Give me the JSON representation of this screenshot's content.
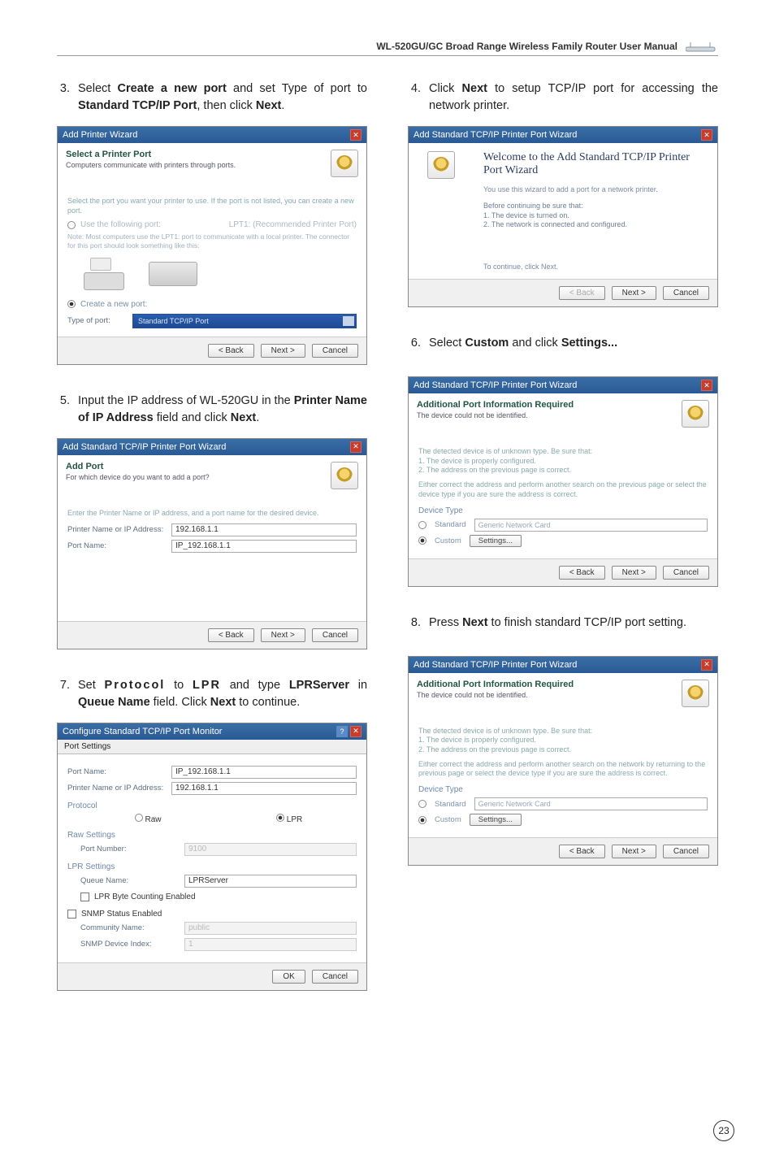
{
  "header": {
    "title": "WL-520GU/GC Broad Range Wireless Family Router User Manual"
  },
  "page_number": "23",
  "steps": {
    "s3": {
      "num": "3.",
      "pre": "Select ",
      "b1": "Create a new port",
      "mid": " and set Type of port to ",
      "b2": "Standard TCP/IP Port",
      "post": ", then click ",
      "b3": "Next",
      "end": "."
    },
    "s4": {
      "num": "4.",
      "pre": "Click ",
      "b1": "Next",
      "post": " to setup TCP/IP port for accessing the network printer."
    },
    "s5": {
      "num": "5.",
      "pre": "Input the IP address of WL-520GU in the ",
      "b1": "Printer Name of IP Address",
      "mid": " field and click ",
      "b2": "Next",
      "end": "."
    },
    "s6": {
      "num": "6.",
      "pre": "Select ",
      "b1": "Custom",
      "mid": " and click ",
      "b2": "Settings...",
      "end": ""
    },
    "s7": {
      "num": "7.",
      "pre": "Set ",
      "b1": "Protocol",
      "mid1": " to ",
      "b2": "LPR",
      "mid2": " and type ",
      "b3": "LPRServer",
      "mid3": " in ",
      "b4": "Queue Name",
      "mid4": " field. Click ",
      "b5": "Next",
      "post": " to continue."
    },
    "s8": {
      "num": "8.",
      "pre": "Press ",
      "b1": "Next",
      "post": " to finish standard TCP/IP port setting."
    }
  },
  "dlg3": {
    "title": "Add Printer Wizard",
    "head_title": "Select a Printer Port",
    "head_sub": "Computers communicate with printers through ports.",
    "note": "Select the port you want your printer to use. If the port is not listed, you can create a new port.",
    "opt_use": "Use the following port:",
    "opt_use_val": "LPT1: (Recommended Printer Port)",
    "blurb": "Note: Most computers use the LPT1: port to communicate with a local printer. The connector for this port should look something like this:",
    "opt_create": "Create a new port:",
    "type_label": "Type of port:",
    "type_val": "Standard TCP/IP Port",
    "btn_back": "< Back",
    "btn_next": "Next >",
    "btn_cancel": "Cancel"
  },
  "dlg4": {
    "title": "Add Standard TCP/IP Printer Port Wizard",
    "welcome": "Welcome to the Add Standard TCP/IP Printer Port Wizard",
    "sub": "You use this wizard to add a port for a network printer.",
    "bul_intro": "Before continuing be sure that:",
    "bul1": "1. The device is turned on.",
    "bul2": "2. The network is connected and configured.",
    "bottom": "To continue, click Next.",
    "btn_back": "< Back",
    "btn_next": "Next >",
    "btn_cancel": "Cancel"
  },
  "dlg5": {
    "title": "Add Standard TCP/IP Printer Port Wizard",
    "head_title": "Add Port",
    "head_sub": "For which device do you want to add a port?",
    "prompt": "Enter the Printer Name or IP address, and a port name for the desired device.",
    "f1_label": "Printer Name or IP Address:",
    "f1_val": "192.168.1.1",
    "f2_label": "Port Name:",
    "f2_val": "IP_192.168.1.1",
    "btn_back": "< Back",
    "btn_next": "Next >",
    "btn_cancel": "Cancel"
  },
  "dlg6": {
    "title": "Add Standard TCP/IP Printer Port Wizard",
    "head_title": "Additional Port Information Required",
    "head_sub": "The device could not be identified.",
    "para1": "The detected device is of unknown type. Be sure that:\n1. The device is properly configured.\n2. The address on the previous page is correct.",
    "para2": "Either correct the address and perform another search on the previous page or select the device type if you are sure the address is correct.",
    "devtype_label": "Device Type",
    "opt_std": "Standard",
    "opt_std_val": "Generic Network Card",
    "opt_custom": "Custom",
    "settings_btn": "Settings...",
    "btn_back": "< Back",
    "btn_next": "Next >",
    "btn_cancel": "Cancel"
  },
  "dlg7": {
    "title": "Configure Standard TCP/IP Port Monitor",
    "tab": "Port Settings",
    "f_portname_l": "Port Name:",
    "f_portname_v": "IP_192.168.1.1",
    "f_addr_l": "Printer Name or IP Address:",
    "f_addr_v": "192.168.1.1",
    "sec_protocol": "Protocol",
    "opt_raw": "Raw",
    "opt_lpr": "LPR",
    "sec_raw": "Raw Settings",
    "raw_port_l": "Port Number:",
    "raw_port_v": "9100",
    "sec_lpr": "LPR Settings",
    "lpr_q_l": "Queue Name:",
    "lpr_q_v": "LPRServer",
    "chk_lprcount": "LPR Byte Counting Enabled",
    "chk_snmp": "SNMP Status Enabled",
    "snmp_comm_l": "Community Name:",
    "snmp_comm_v": "public",
    "snmp_idx_l": "SNMP Device Index:",
    "snmp_idx_v": "1",
    "btn_ok": "OK",
    "btn_cancel": "Cancel"
  },
  "dlg8": {
    "title": "Add Standard TCP/IP Printer Port Wizard",
    "head_title": "Additional Port Information Required",
    "head_sub": "The device could not be identified.",
    "para1": "The detected device is of unknown type. Be sure that:\n1. The device is properly configured.\n2. The address on the previous page is correct.",
    "para2": "Either correct the address and perform another search on the network by returning to the previous page or select the device type if you are sure the address is correct.",
    "devtype_label": "Device Type",
    "opt_std": "Standard",
    "opt_std_val": "Generic Network Card",
    "opt_custom": "Custom",
    "settings_btn": "Settings...",
    "btn_back": "< Back",
    "btn_next": "Next >",
    "btn_cancel": "Cancel"
  }
}
